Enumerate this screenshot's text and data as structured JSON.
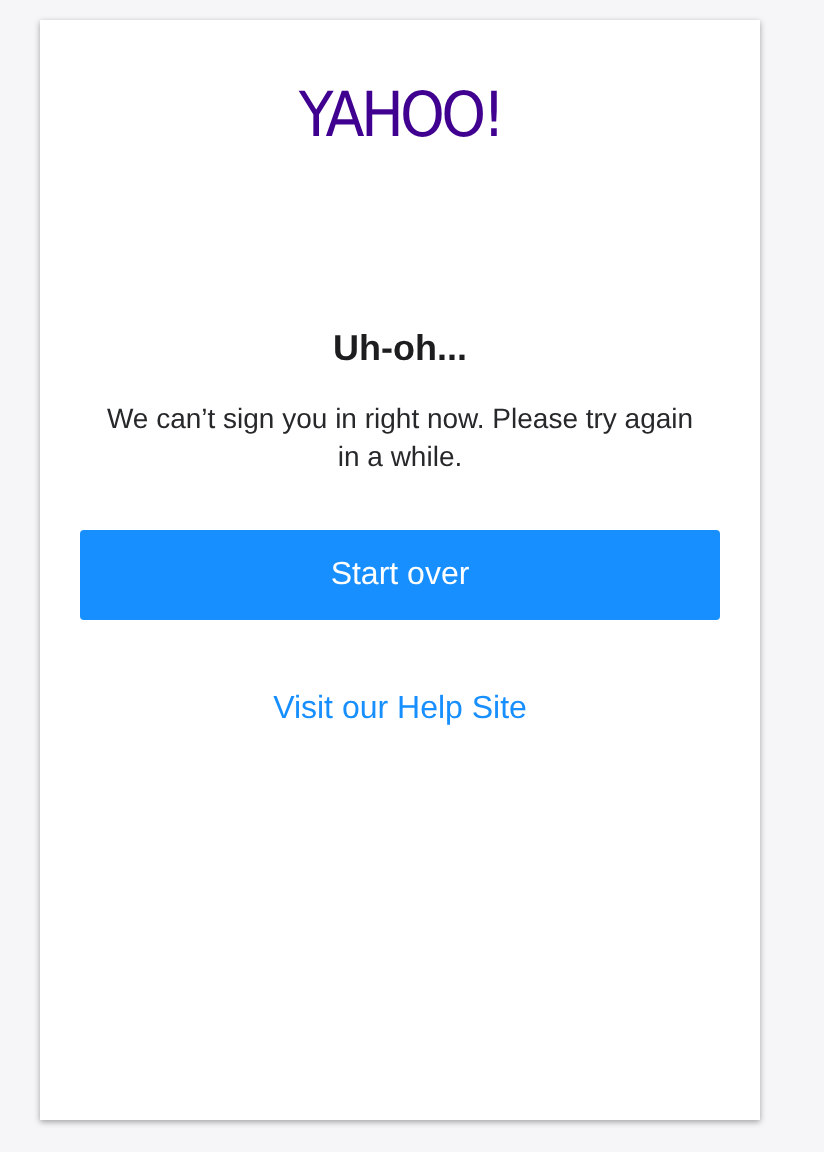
{
  "logo": "YAHOO!",
  "title": "Uh-oh...",
  "message": "We can’t sign you in right now. Please try again in a while.",
  "button": "Start over",
  "help_link": "Visit our Help Site"
}
